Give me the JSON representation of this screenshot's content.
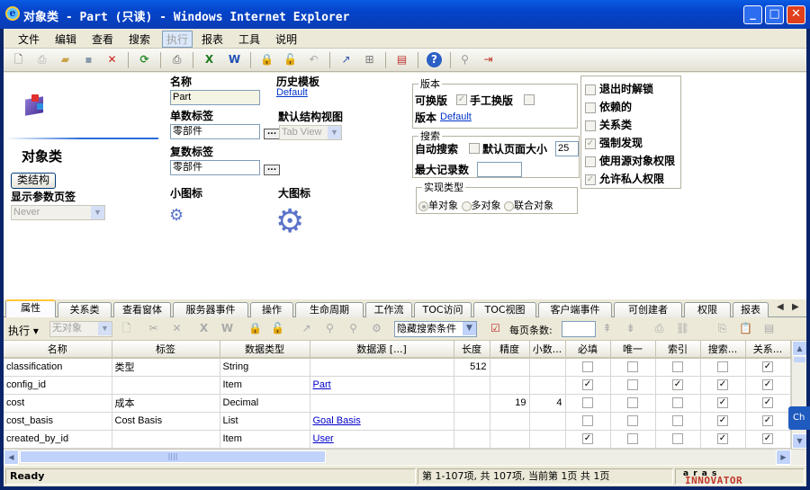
{
  "window": {
    "title": "对象类 - Part (只读) - Windows Internet Explorer",
    "icon": "ie-icon"
  },
  "menu": [
    "文件",
    "编辑",
    "查看",
    "搜索",
    "执行",
    "报表",
    "工具",
    "说明"
  ],
  "menu_disabled": "执行",
  "form": {
    "heading": "对象类",
    "class_structure_button": "类结构",
    "show_param_tab_label": "显示参数页签",
    "show_param_tab_value": "Never",
    "name_label": "名称",
    "name_value": "Part",
    "history_template_label": "历史模板",
    "history_template_value": "Default",
    "singular_label_label": "单数标签",
    "singular_label_value": "零部件",
    "default_view_label": "默认结构视图",
    "default_view_value": "Tab View",
    "plural_label_label": "复数标签",
    "plural_label_value": "零部件",
    "small_icon_label": "小图标",
    "large_icon_label": "大图标",
    "version_group": {
      "legend": "版本",
      "versionable_label": "可换版",
      "manual_version_label": "手工换版",
      "version_label": "版本",
      "version_value": "Default"
    },
    "search_group": {
      "legend": "搜索",
      "auto_search_label": "自动搜索",
      "default_page_size_label": "默认页面大小",
      "default_page_size_value": "25",
      "max_records_label": "最大记录数",
      "max_records_value": ""
    },
    "impl_group": {
      "legend": "实现类型",
      "options": [
        "单对象",
        "多对象",
        "联合对象"
      ],
      "selected": "单对象"
    },
    "options": [
      {
        "label": "退出时解锁",
        "checked": false
      },
      {
        "label": "依赖的",
        "checked": false
      },
      {
        "label": "关系类",
        "checked": false
      },
      {
        "label": "强制发现",
        "checked": true
      },
      {
        "label": "使用源对象权限",
        "checked": false
      },
      {
        "label": "允许私人权限",
        "checked": true
      }
    ]
  },
  "tabs": [
    "属性",
    "关系类",
    "查看窗体",
    "服务器事件",
    "操作",
    "生命周期",
    "工作流",
    "TOC访问",
    "TOC视图",
    "客户端事件",
    "可创建者",
    "权限",
    "报表"
  ],
  "active_tab": "属性",
  "grid_toolbar": {
    "execute_label": "执行",
    "no_object_value": "无对象",
    "hidden_search_value": "隐藏搜索条件",
    "page_size_label": "每页条数:"
  },
  "grid": {
    "columns": [
      "名称",
      "标签",
      "数据类型",
      "数据源 [...]",
      "长度",
      "精度",
      "小数...",
      "必填",
      "唯一",
      "索引",
      "搜索...",
      "关系..."
    ],
    "rows": [
      {
        "name": "classification",
        "label": "类型",
        "type": "String",
        "source": "",
        "length": "512",
        "precision": "",
        "scale": "",
        "required": false,
        "unique": false,
        "indexed": false,
        "search": false,
        "rel": true
      },
      {
        "name": "config_id",
        "label": "",
        "type": "Item",
        "source": "Part",
        "length": "",
        "precision": "",
        "scale": "",
        "required": true,
        "unique": false,
        "indexed": true,
        "search": true,
        "rel": true
      },
      {
        "name": "cost",
        "label": "成本",
        "type": "Decimal",
        "source": "",
        "length": "",
        "precision": "19",
        "scale": "4",
        "required": false,
        "unique": false,
        "indexed": false,
        "search": true,
        "rel": true
      },
      {
        "name": "cost_basis",
        "label": "Cost Basis",
        "type": "List",
        "source": "Goal Basis",
        "length": "",
        "precision": "",
        "scale": "",
        "required": false,
        "unique": false,
        "indexed": false,
        "search": true,
        "rel": true
      },
      {
        "name": "created_by_id",
        "label": "",
        "type": "Item",
        "source": "User",
        "length": "",
        "precision": "",
        "scale": "",
        "required": true,
        "unique": false,
        "indexed": false,
        "search": true,
        "rel": true
      }
    ]
  },
  "status": {
    "ready": "Ready",
    "paging": "第 1-107项, 共 107项, 当前第 1页 共 1页",
    "brand_top": "a r a s",
    "brand": "INNOVATOR"
  },
  "side_tag": "Ch"
}
